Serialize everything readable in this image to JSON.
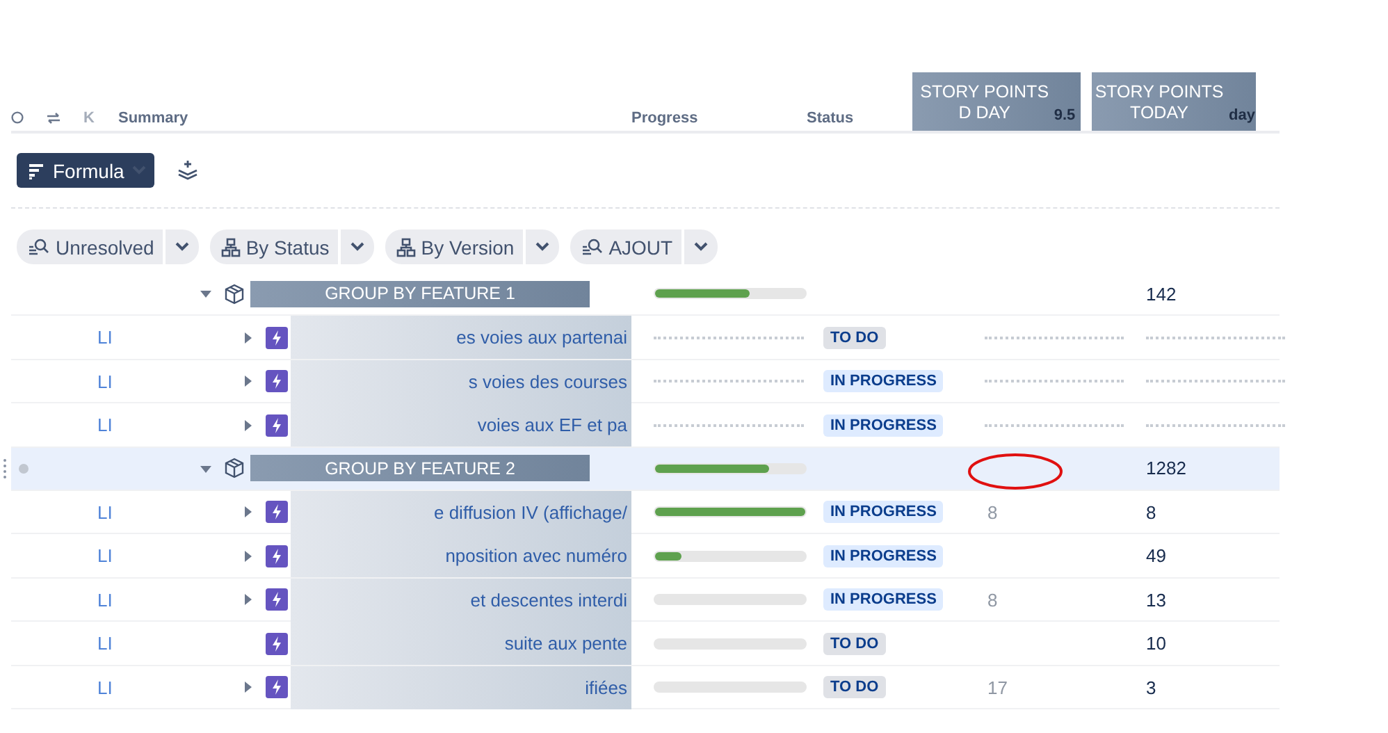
{
  "header": {
    "key": "K",
    "summary": "Summary",
    "progress": "Progress",
    "status": "Status",
    "overlays": [
      {
        "title": "STORY POINTS D DAY",
        "peek": "9.5"
      },
      {
        "title": "STORY POINTS TODAY",
        "peek": "day"
      }
    ]
  },
  "toolbar": {
    "formula": "Formula"
  },
  "filters": [
    {
      "label": "Unresolved",
      "kind": "search"
    },
    {
      "label": "By Status",
      "kind": "group"
    },
    {
      "label": "By Version",
      "kind": "group"
    },
    {
      "label": "AJOUT",
      "kind": "search"
    }
  ],
  "rows": [
    {
      "kind": "group",
      "title": "GROUP BY FEATURE 1",
      "level": 0.63,
      "today": "142",
      "selected": false,
      "expanded": true,
      "annotated": false
    },
    {
      "kind": "item",
      "key": "LI",
      "summary": "es voies aux partenai",
      "loading": true,
      "status": {
        "label": "TO DO",
        "color": "#dfe1e6"
      },
      "expandable": true
    },
    {
      "kind": "item",
      "key": "LI",
      "summary": "s voies des courses",
      "loading": true,
      "status": {
        "label": "IN PROGRESS",
        "color": "#deebff"
      },
      "expandable": true
    },
    {
      "kind": "item",
      "key": "LI",
      "summary": "voies aux EF et pa",
      "loading": true,
      "status": {
        "label": "IN PROGRESS",
        "color": "#deebff"
      },
      "expandable": true
    },
    {
      "kind": "group",
      "title": "GROUP BY FEATURE 2",
      "level": 0.76,
      "today": "1282",
      "selected": true,
      "expanded": true,
      "annotated": true
    },
    {
      "kind": "item",
      "key": "LI",
      "summary": "e diffusion IV (affichage/",
      "loading": false,
      "level": 1,
      "status": {
        "label": "IN PROGRESS",
        "color": "#deebff"
      },
      "d_day": "8",
      "today": "8",
      "expandable": true
    },
    {
      "kind": "item",
      "key": "LI",
      "summary": "nposition avec numéro",
      "loading": false,
      "level": 0.18,
      "status": {
        "label": "IN PROGRESS",
        "color": "#deebff"
      },
      "today": "49",
      "expandable": true
    },
    {
      "kind": "item",
      "key": "LI",
      "summary": "et descentes interdi",
      "loading": false,
      "status": {
        "label": "IN PROGRESS",
        "color": "#deebff"
      },
      "d_day": "8",
      "today": "13",
      "expandable": true
    },
    {
      "kind": "item",
      "key": "LI",
      "summary": "suite aux pente",
      "loading": false,
      "status": {
        "label": "TO DO",
        "color": "#dfe1e6"
      },
      "today": "10",
      "expandable": false
    },
    {
      "kind": "item",
      "key": "LI",
      "summary": "ifiées",
      "loading": false,
      "status": {
        "label": "TO DO",
        "color": "#dfe1e6"
      },
      "d_day": "17",
      "today": "3",
      "expandable": true
    }
  ]
}
